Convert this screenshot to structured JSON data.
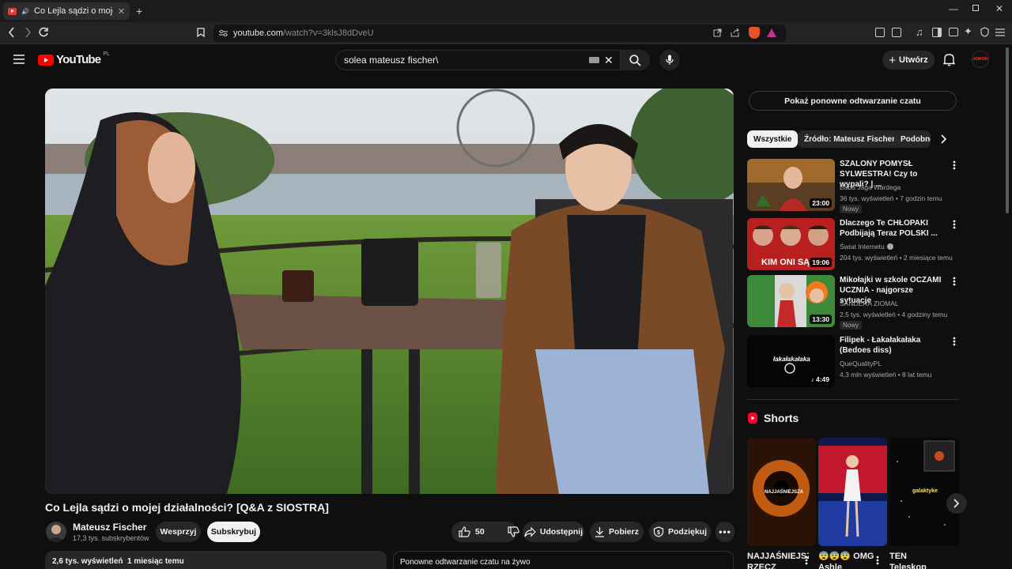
{
  "browser": {
    "tab_title": "Co Lejla sądzi o mojej działal",
    "url_host": "youtube.com",
    "url_path": "/watch?v=3klsJ8dDveU"
  },
  "header": {
    "logo_text": "YouTube",
    "region": "PL",
    "search_value": "solea mateusz fischer\\",
    "create_label": "Utwórz",
    "avatar_text": "ADRON"
  },
  "video": {
    "title": "Co Lejla sądzi o mojej działalności? [Q&A z SIOSTRĄ]",
    "channel_name": "Mateusz Fischer",
    "channel_subs": "17,3 tys. subskrybentów",
    "support_label": "Wesprzyj",
    "subscribe_label": "Subskrybuj",
    "likes": "50",
    "share_label": "Udostępnij",
    "download_label": "Pobierz",
    "thanks_label": "Podziękuj",
    "views_and_date": "2,6 tys. wyświetleń  1 miesiąc temu",
    "chat_replay_box": "Ponowne odtwarzanie czatu na żywo"
  },
  "sidebar": {
    "chat_replay_button": "Pokaż ponowne odtwarzanie czatu",
    "chips": [
      "Wszystkie",
      "Źródło: Mateusz Fischer",
      "Podobne"
    ],
    "recommendations": [
      {
        "title": "SZALONY POMYSŁ SYLWESTRA! Czy to wypali? | ...",
        "channel": "Baba Jaga Wardega",
        "meta": "36 tys. wyświetleń • 7 godzin temu",
        "badge": "Nowy",
        "duration": "23:00"
      },
      {
        "title": "Dlaczego Te CHŁOPAKI Podbijają Teraz POLSKI ...",
        "channel": "Świat Internetu",
        "meta": "204 tys. wyświetleń • 2 miesiące temu",
        "badge": "",
        "duration": "19:06",
        "thumb_text": "KIM ONI SĄ"
      },
      {
        "title": "Mikołajki w szkole OCZAMI UCZNIA - najgorsze sytuacje",
        "channel": "SANDERA ZIOMAL",
        "meta": "2,5 tys. wyświetleń • 4 godziny temu",
        "badge": "Nowy",
        "duration": "13:30"
      },
      {
        "title": "Filipek - Łakałakałaka (Bedoes diss)",
        "channel": "QueQualityPL",
        "meta": "4,3 mln wyświetleń • 8 lat temu",
        "badge": "",
        "duration": "4:49",
        "thumb_text": "łakałakałaka"
      }
    ],
    "shorts_label": "Shorts",
    "shorts": [
      {
        "title": "NAJJAŚNIEJSZA RZECZ",
        "thumb_text": "NAJJAŚNIEJSZA"
      },
      {
        "title": "😨😨😨 OMG Ashle",
        "thumb_text": ""
      },
      {
        "title": "TEN Teleskop",
        "thumb_text": "galaktyke"
      }
    ]
  }
}
